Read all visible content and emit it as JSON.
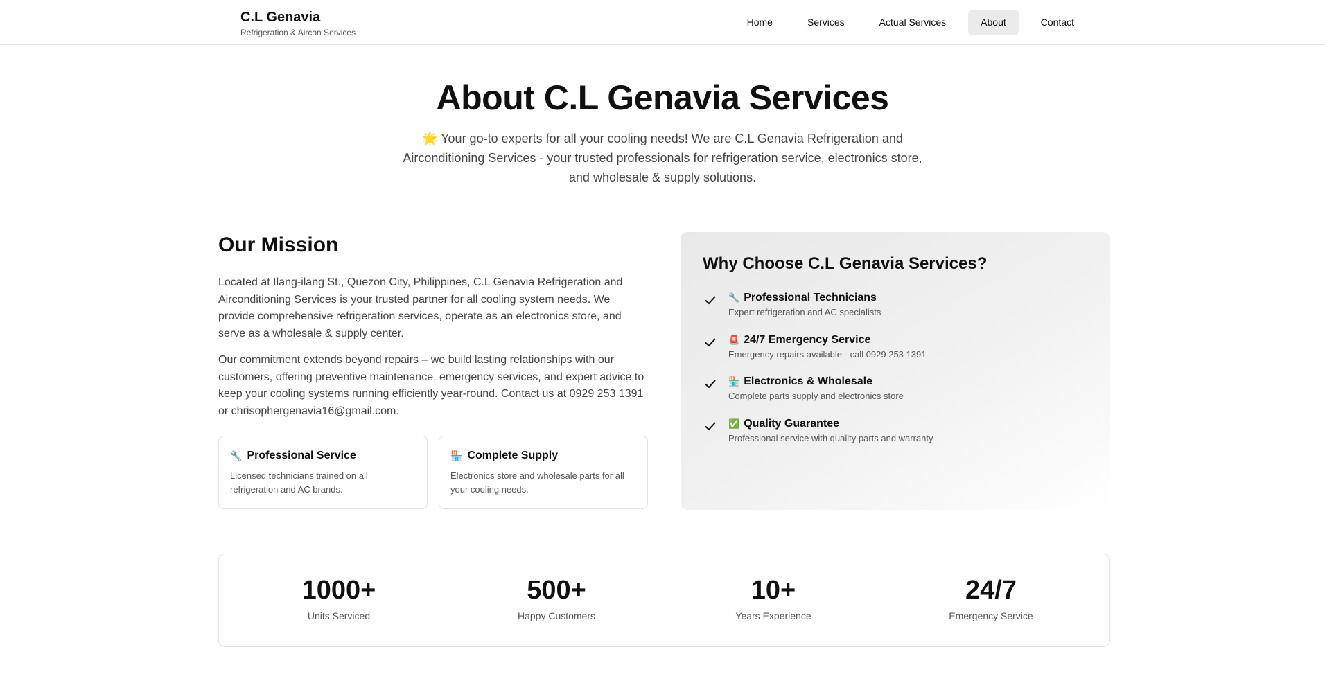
{
  "nav": {
    "brand_name": "C.L Genavia",
    "brand_sub": "Refrigeration & Aircon Services",
    "links": [
      {
        "label": "Home"
      },
      {
        "label": "Services"
      },
      {
        "label": "Actual Services"
      },
      {
        "label": "About"
      },
      {
        "label": "Contact"
      }
    ]
  },
  "hero": {
    "title": "About C.L Genavia Services",
    "icon": "🌟",
    "description": "Your go-to experts for all your cooling needs! We are C.L Genavia Refrigeration and Airconditioning Services - your trusted professionals for refrigeration service, electronics store, and wholesale & supply solutions."
  },
  "mission": {
    "title": "Our Mission",
    "p1": "Located at Ilang-ilang St., Quezon City, Philippines, C.L Genavia Refrigeration and Airconditioning Services is your trusted partner for all cooling system needs. We provide comprehensive refrigeration services, operate as an electronics store, and serve as a wholesale & supply center.",
    "p2": "Our commitment extends beyond repairs – we build lasting relationships with our customers, offering preventive maintenance, emergency services, and expert advice to keep your cooling systems running efficiently year-round. Contact us at 0929 253 1391 or chrisophergenavia16@gmail.com.",
    "cards": [
      {
        "icon": "🔧",
        "title": "Professional Service",
        "text": "Licensed technicians trained on all refrigeration and AC brands."
      },
      {
        "icon": "🏪",
        "title": "Complete Supply",
        "text": "Electronics store and wholesale parts for all your cooling needs."
      }
    ]
  },
  "why": {
    "title": "Why Choose C.L Genavia Services?",
    "items": [
      {
        "icon": "🔧",
        "title": "Professional Technicians",
        "text": "Expert refrigeration and AC specialists"
      },
      {
        "icon": "🚨",
        "title": "24/7 Emergency Service",
        "text": "Emergency repairs available - call 0929 253 1391"
      },
      {
        "icon": "🏪",
        "title": "Electronics & Wholesale",
        "text": "Complete parts supply and electronics store"
      },
      {
        "icon": "✅",
        "title": "Quality Guarantee",
        "text": "Professional service with quality parts and warranty"
      }
    ]
  },
  "stats": [
    {
      "value": "1000+",
      "label": "Units Serviced"
    },
    {
      "value": "500+",
      "label": "Happy Customers"
    },
    {
      "value": "10+",
      "label": "Years Experience"
    },
    {
      "value": "24/7",
      "label": "Emergency Service"
    }
  ],
  "colors": {
    "text": "#111111",
    "muted": "#444444",
    "border": "#e2e2e2",
    "active_nav_bg": "#ebebeb",
    "panel_bg": "#ececec"
  }
}
